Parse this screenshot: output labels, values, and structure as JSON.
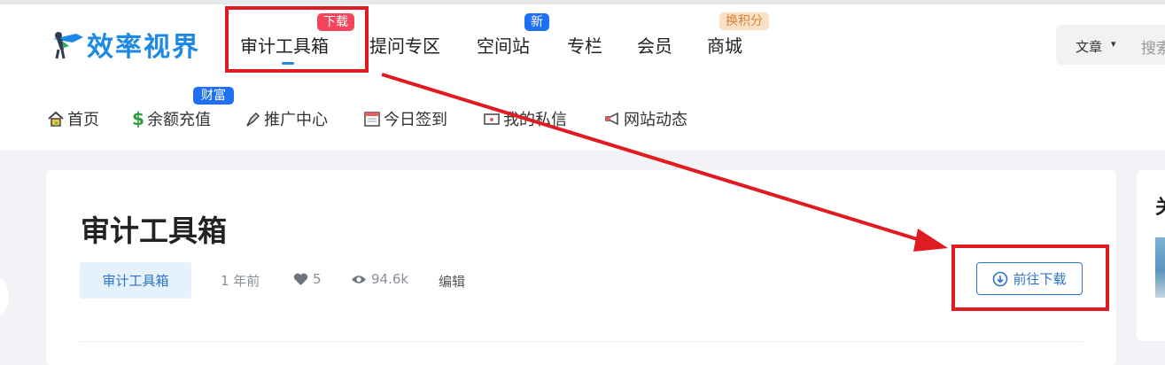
{
  "logo": {
    "text": "效率视界",
    "icon": "flying-person-logo"
  },
  "nav": {
    "items": [
      {
        "label": "审计工具箱",
        "badge": "下载"
      },
      {
        "label": "提问专区"
      },
      {
        "label": "空间站",
        "badge": "新"
      },
      {
        "label": "专栏"
      },
      {
        "label": "会员"
      },
      {
        "label": "商城",
        "badge": "换积分"
      }
    ],
    "active": "审计工具箱"
  },
  "search": {
    "category": "文章",
    "placeholder": "搜索"
  },
  "subnav": {
    "items": [
      {
        "label": "首页",
        "icon": "home-icon"
      },
      {
        "label": "余额充值",
        "icon": "dollar-icon",
        "badge": "财富"
      },
      {
        "label": "推广中心",
        "icon": "brush-icon"
      },
      {
        "label": "今日签到",
        "icon": "calendar-icon"
      },
      {
        "label": "我的私信",
        "icon": "mail-icon"
      },
      {
        "label": "网站动态",
        "icon": "megaphone-icon"
      }
    ]
  },
  "article": {
    "title": "审计工具箱",
    "tag": "审计工具箱",
    "time": "1 年前",
    "likes": "5",
    "views": "94.6k",
    "edit": "编辑",
    "download_label": "前往下载"
  },
  "sidebar": {
    "title_partial": "关"
  },
  "colors": {
    "accent": "#1e88e5",
    "annotation": "#e11b22",
    "badge_red": "#f5455c",
    "badge_blue": "#1e6ff2"
  }
}
